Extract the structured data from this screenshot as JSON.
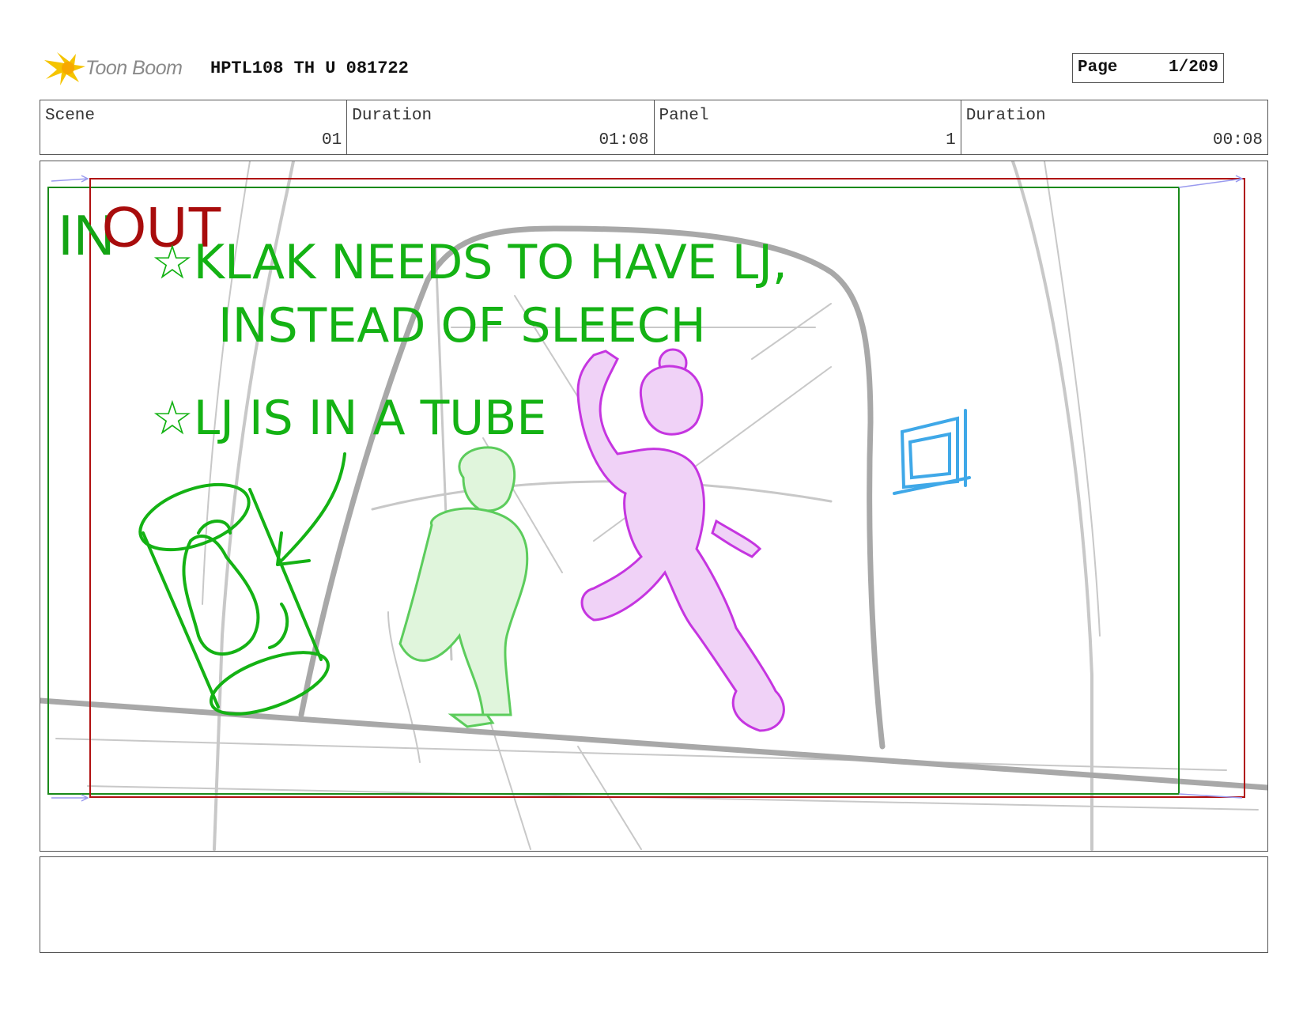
{
  "header": {
    "logo_text": "Toon Boom",
    "document_title": "HPTL108 TH U 081722",
    "page_label": "Page",
    "page_value": "1/209"
  },
  "info": {
    "scene_label": "Scene",
    "scene_value": "01",
    "scene_duration_label": "Duration",
    "scene_duration_value": "01:08",
    "panel_label": "Panel",
    "panel_value": "1",
    "panel_duration_label": "Duration",
    "panel_duration_value": "00:08"
  },
  "panel": {
    "in_marker": "IN",
    "out_marker": "OUT",
    "note_line_1": "☆KLAK NEEDS TO HAVE LJ,",
    "note_line_2": "INSTEAD OF SLEECH",
    "note_line_3": "☆LJ IS IN A TUBE",
    "colors": {
      "in_frame": "#1a8a1a",
      "out_frame": "#b01010",
      "note": "#14b214",
      "character_1": "#5ccc5c",
      "character_2": "#c535e0",
      "window": "#3fa8e8",
      "background_lines": "#c8c8c8"
    }
  },
  "notes_box": {
    "text": ""
  }
}
